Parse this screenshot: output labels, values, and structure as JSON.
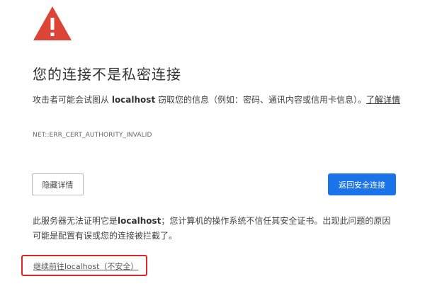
{
  "icons": {
    "warning": "warning-triangle-icon",
    "warning_color": "#db4437"
  },
  "title": "您的连接不是私密连接",
  "description": {
    "prefix": "攻击者可能会试图从 ",
    "host": "localhost",
    "suffix": " 窃取您的信息（例如：密码、通讯内容或信用卡信息）。",
    "learn_more": "了解详情"
  },
  "error_code": "NET::ERR_CERT_AUTHORITY_INVALID",
  "buttons": {
    "hide_details": "隐藏详情",
    "back_to_safety": "返回安全连接",
    "primary_color": "#1a73e8"
  },
  "details": {
    "prefix": "此服务器无法证明它是",
    "host": "localhost",
    "suffix": "；您计算机的操作系统不信任其安全证书。出现此问题的原因可能是配置有误或您的连接被拦截了。"
  },
  "proceed_link": "继续前往localhost（不安全）",
  "highlight_color": "#d9262b"
}
